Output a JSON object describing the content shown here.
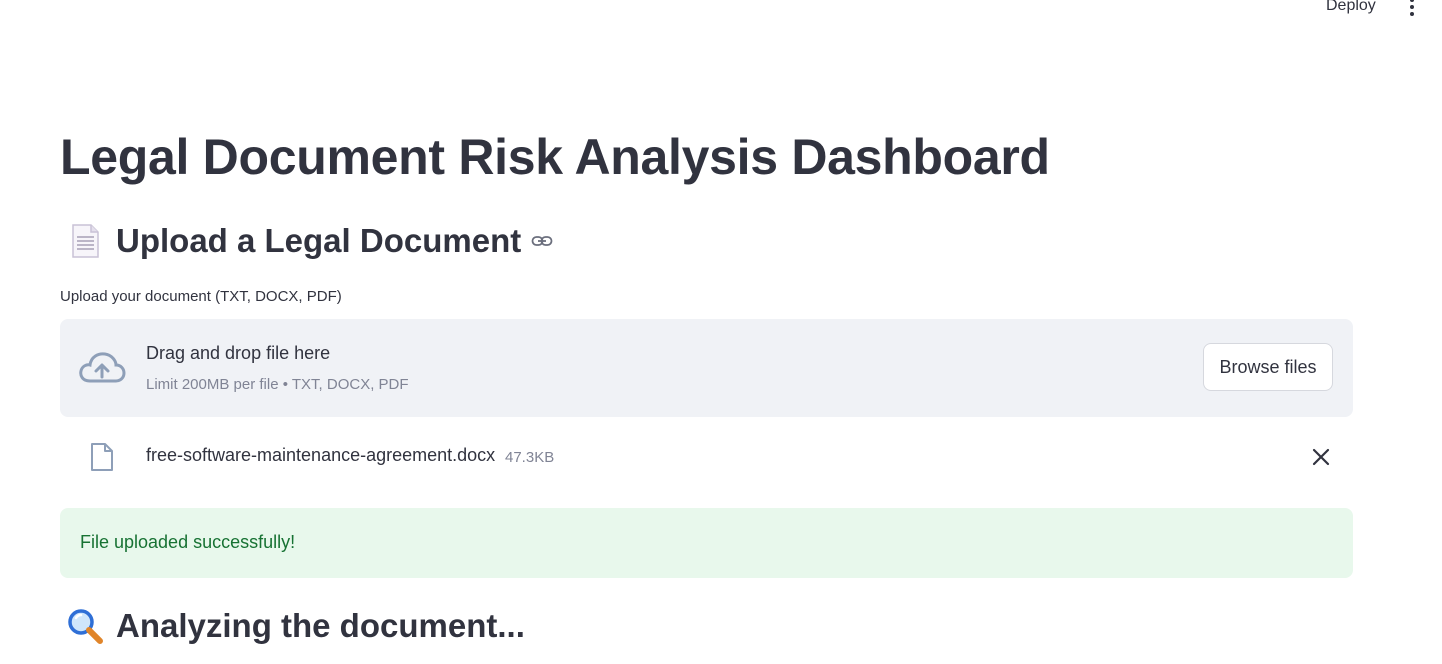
{
  "header": {
    "deploy_label": "Deploy",
    "menu_icon": "kebab-menu-icon"
  },
  "page": {
    "title": "Legal Document Risk Analysis Dashboard"
  },
  "upload_section": {
    "heading": "Upload a Legal Document",
    "heading_emoji": "📄",
    "anchor_icon": "link-icon",
    "field_label": "Upload your document (TXT, DOCX, PDF)",
    "dropzone": {
      "icon": "cloud-upload-icon",
      "title": "Drag and drop file here",
      "subtitle": "Limit 200MB per file • TXT, DOCX, PDF",
      "browse_label": "Browse files"
    },
    "uploaded_file": {
      "icon": "file-icon",
      "name": "free-software-maintenance-agreement.docx",
      "size": "47.3KB",
      "remove_icon": "close-icon"
    }
  },
  "status": {
    "success_message": "File uploaded successfully!",
    "success_bg": "#e8f8ec",
    "success_color": "#177233"
  },
  "analysis_section": {
    "heading": "Analyzing the document...",
    "heading_emoji": "🔍"
  }
}
